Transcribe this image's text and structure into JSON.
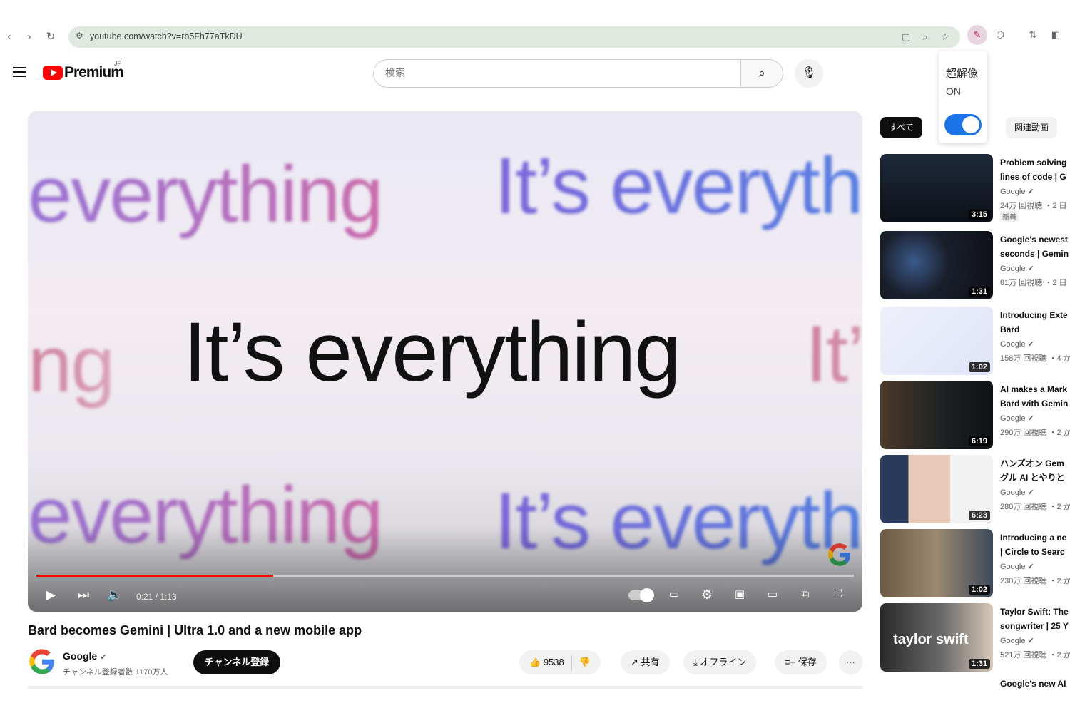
{
  "browser": {
    "back": "‹",
    "forward": "›",
    "reload": "↻",
    "url": "youtube.com/watch?v=rb5Fh77aTkDU"
  },
  "extension_popup": {
    "title": "超解像",
    "state": "ON",
    "enabled": true
  },
  "header": {
    "logo_text": "Premium",
    "logo_badge": "JP",
    "search_placeholder": "検索"
  },
  "player": {
    "frame_words": {
      "top_left": "everything",
      "top_right": "It’s everythi",
      "mid_left": "ng",
      "center": "It’s everything",
      "mid_right": "It’s",
      "bottom_left": "everything",
      "bottom_right": "It’s everyth"
    },
    "time": "0:21 / 1:13",
    "progress_fraction": 0.29
  },
  "video": {
    "title": "Bard becomes Gemini | Ultra 1.0 and a new mobile app",
    "channel": "Google",
    "subscribers": "チャンネル登録者数 1170万人",
    "subscribe_label": "チャンネル登録",
    "likes": "9538",
    "share_label": "共有",
    "offline_label": "オフライン",
    "save_label": "保存",
    "more_label": "⋯"
  },
  "chips": [
    "すべて",
    "関連動画"
  ],
  "recommendations": [
    {
      "title1": "Problem solving",
      "title2": "lines of code | G",
      "channel": "Google",
      "meta": "24万 回視聴 ・2 日",
      "badge": "新着",
      "duration": "3:15",
      "thumb": "dark-chart"
    },
    {
      "title1": "Google's newest",
      "title2": "seconds | Gemin",
      "channel": "Google",
      "meta": "81万 回視聴 ・2 日",
      "badge": "",
      "duration": "1:31",
      "thumb": "dark-diagram"
    },
    {
      "title1": "Introducing Exte",
      "title2": "Bard",
      "channel": "Google",
      "meta": "158万 回視聴 ・4 か",
      "badge": "",
      "duration": "1:02",
      "thumb": "light-bard"
    },
    {
      "title1": "AI makes a Mark",
      "title2": "Bard with Gemin",
      "channel": "Google",
      "meta": "290万 回視聴 ・2 か",
      "badge": "",
      "duration": "6:19",
      "thumb": "dark-person"
    },
    {
      "title1": "ハンズオン Gem",
      "title2": "グル AI とやりと",
      "channel": "Google",
      "meta": "280万 回視聴 ・2 か",
      "badge": "",
      "duration": "6:23",
      "thumb": "hands"
    },
    {
      "title1": "Introducing a ne",
      "title2": "| Circle to Searc",
      "channel": "Google",
      "meta": "230万 回視聴 ・2 か",
      "badge": "",
      "duration": "1:02",
      "thumb": "phone"
    },
    {
      "title1": "Taylor Swift: The",
      "title2": "songwriter | 25 Y",
      "channel": "Google",
      "meta": "521万 回視聴 ・2 か",
      "badge": "",
      "duration": "1:31",
      "thumb": "taylor",
      "thumb_text": "taylor swift"
    }
  ],
  "last_title": "Google's new AI"
}
